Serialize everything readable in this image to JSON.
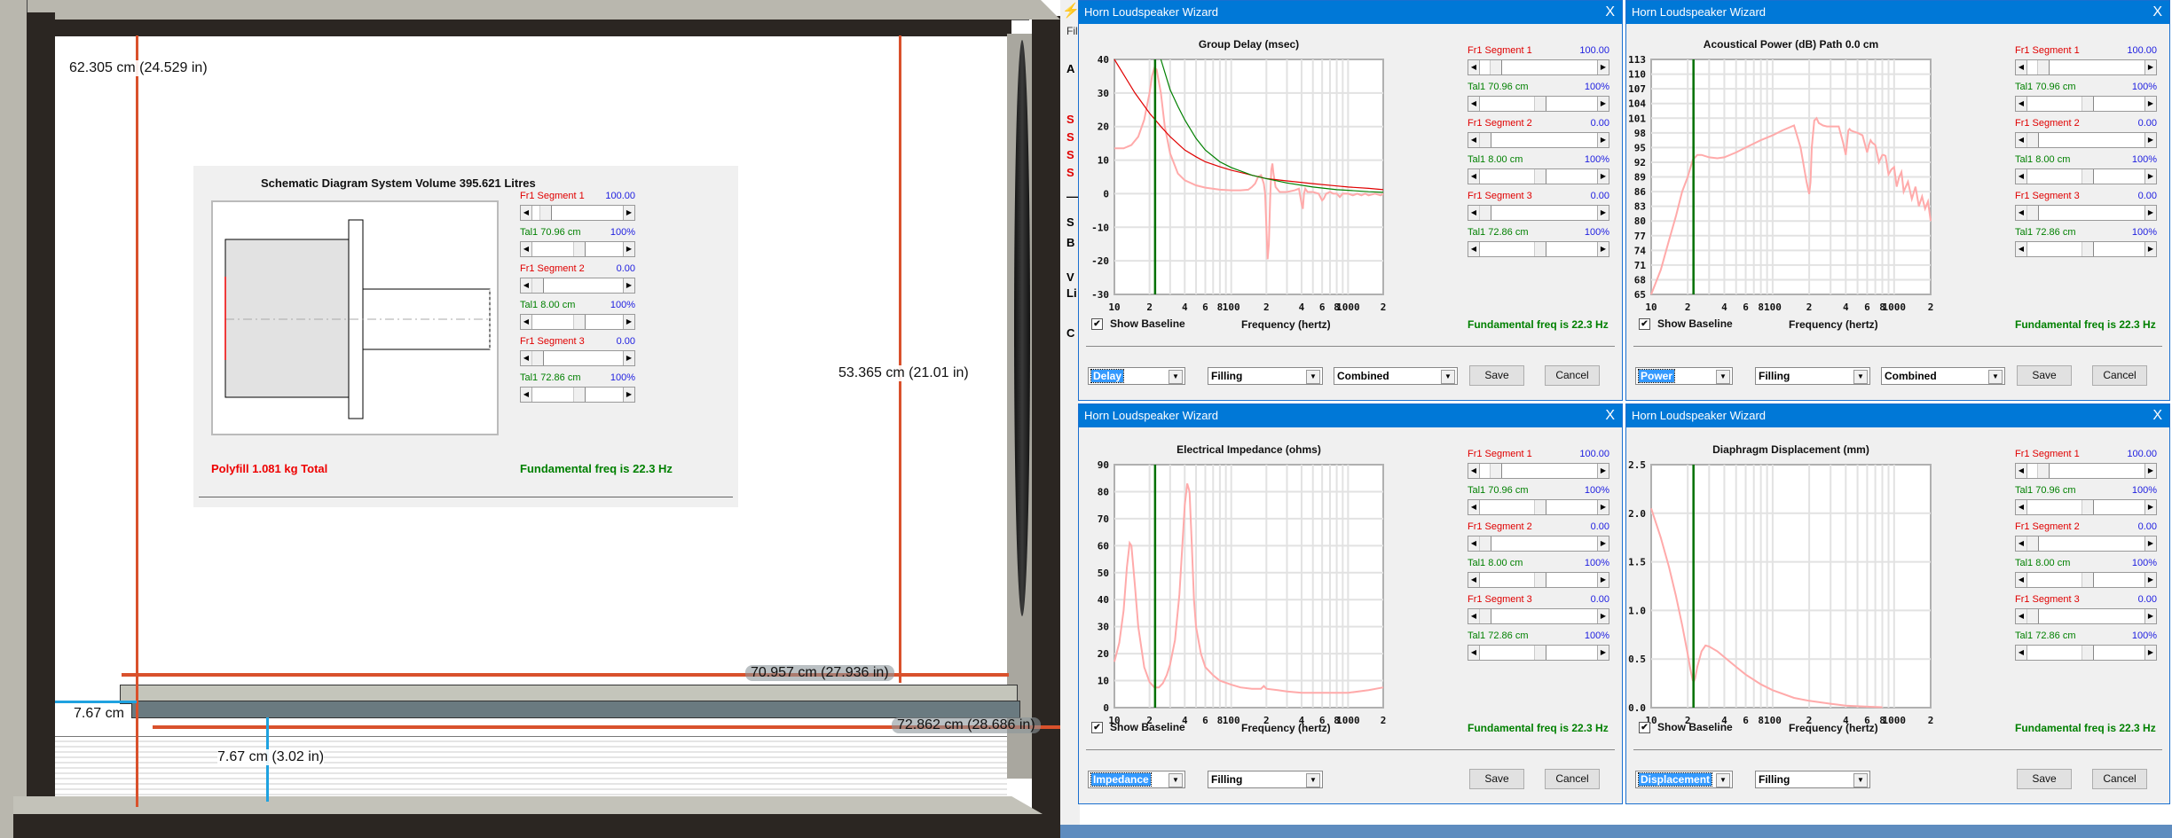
{
  "view3d": {
    "dimensions": {
      "height_left": "62.305 cm (24.529 in)",
      "height_right": "53.365 cm (21.01 in)",
      "panel_length": "70.957 cm (27.936 in)",
      "floor_length": "72.862 cm (28.686 in)",
      "gap_left": "7.67 cm",
      "gap_bottom": "7.67 cm (3.02 in)"
    }
  },
  "schematic": {
    "title": "Schematic Diagram   System Volume 395.621 Litres",
    "polyfill": "Polyfill   1.081 kg   Total",
    "fundamental": "Fundamental freq is 22.3 Hz",
    "sliders": [
      {
        "label": "Fr1  Segment 1",
        "value": "100.00",
        "color": "red",
        "thumb": 0.1
      },
      {
        "label": "Tal1  70.96 cm",
        "value": "100%",
        "color": "green",
        "thumb": 0.5
      },
      {
        "label": "Fr1  Segment 2",
        "value": "0.00",
        "color": "red",
        "thumb": 0.0
      },
      {
        "label": "Tal1  8.00 cm",
        "value": "100%",
        "color": "green",
        "thumb": 0.5
      },
      {
        "label": "Fr1  Segment 3",
        "value": "0.00",
        "color": "red",
        "thumb": 0.0
      },
      {
        "label": "Tal1  72.86 cm",
        "value": "100%",
        "color": "green",
        "thumb": 0.5
      }
    ]
  },
  "bgapp": {
    "menu": "Fil",
    "letters": [
      {
        "t": "A",
        "color": "#000000"
      },
      {
        "t": "S",
        "color": "#e00000"
      },
      {
        "t": "S",
        "color": "#e00000"
      },
      {
        "t": "S",
        "color": "#e00000"
      },
      {
        "t": "S",
        "color": "#e00000"
      },
      {
        "t": "—",
        "color": "#000000"
      },
      {
        "t": "S",
        "color": "#000000"
      },
      {
        "t": "B",
        "color": "#000000"
      },
      {
        "t": "V",
        "color": "#000000"
      },
      {
        "t": "Li",
        "color": "#000000"
      },
      {
        "t": "C",
        "color": "#000000"
      }
    ]
  },
  "windows": [
    {
      "title": "Horn Loudspeaker Wizard",
      "close": "X",
      "show_baseline": "Show Baseline",
      "baseline_checked": true,
      "xlabel": "Frequency (hertz)",
      "fundamental": "Fundamental freq is 22.3 Hz",
      "selects": [
        "Delay",
        "Filling",
        "Combined"
      ],
      "save": "Save",
      "cancel": "Cancel"
    },
    {
      "title": "Horn Loudspeaker Wizard",
      "close": "X",
      "show_baseline": "Show Baseline",
      "baseline_checked": true,
      "xlabel": "Frequency (hertz)",
      "fundamental": "Fundamental freq is 22.3 Hz",
      "selects": [
        "Power",
        "Filling",
        "Combined"
      ],
      "save": "Save",
      "cancel": "Cancel"
    },
    {
      "title": "Horn Loudspeaker Wizard",
      "close": "X",
      "show_baseline": "Show Baseline",
      "baseline_checked": true,
      "xlabel": "Frequency (hertz)",
      "fundamental": "Fundamental freq is 22.3 Hz",
      "selects": [
        "Impedance",
        "Filling"
      ],
      "save": "Save",
      "cancel": "Cancel"
    },
    {
      "title": "Horn Loudspeaker Wizard",
      "close": "X",
      "show_baseline": "Show Baseline",
      "baseline_checked": true,
      "xlabel": "Frequency (hertz)",
      "fundamental": "Fundamental freq is 22.3 Hz",
      "selects": [
        "Displacement",
        "Filling"
      ],
      "save": "Save",
      "cancel": "Cancel"
    }
  ],
  "chart_data": [
    {
      "type": "line",
      "title": "Group Delay (msec)",
      "xlabel": "Frequency (hertz)",
      "xscale": "log",
      "xlim": [
        10,
        2000
      ],
      "ylim": [
        -30,
        40
      ],
      "yticks": [
        40,
        30,
        20,
        10,
        0,
        -10,
        -20,
        -30
      ],
      "xtick_labels": [
        {
          "v": 10,
          "t": "10"
        },
        {
          "v": 20,
          "t": "2"
        },
        {
          "v": 40,
          "t": "4"
        },
        {
          "v": 60,
          "t": "6"
        },
        {
          "v": 80,
          "t": "8"
        },
        {
          "v": 100,
          "t": "100"
        },
        {
          "v": 200,
          "t": "2"
        },
        {
          "v": 400,
          "t": "4"
        },
        {
          "v": 600,
          "t": "6"
        },
        {
          "v": 800,
          "t": "8"
        },
        {
          "v": 1000,
          "t": "1000"
        },
        {
          "v": 2000,
          "t": "2"
        }
      ],
      "grid": true,
      "marker_freq": 22.3,
      "series": [
        {
          "name": "response",
          "color": "#ffaaaa",
          "x": [
            10,
            12,
            14,
            16,
            18,
            20,
            21,
            22,
            23,
            25,
            27,
            30,
            35,
            40,
            50,
            60,
            80,
            100,
            120,
            140,
            150,
            160,
            170,
            180,
            190,
            195,
            200,
            205,
            210,
            215,
            220,
            225,
            230,
            240,
            260,
            300,
            350,
            380,
            400,
            410,
            420,
            430,
            450,
            500,
            560,
            600,
            620,
            650,
            700,
            750,
            800,
            850,
            900,
            1000,
            1100,
            1200,
            1300,
            1400,
            1500,
            1700,
            1900,
            2000
          ],
          "y": [
            13.5,
            13.5,
            14.5,
            17,
            22,
            30,
            35,
            37.5,
            37,
            30,
            20,
            12,
            6,
            4,
            2.5,
            1.8,
            1.2,
            1,
            1,
            1.2,
            2,
            3,
            5,
            5.5,
            3,
            0,
            -10,
            -19.5,
            -15,
            -2,
            7,
            9,
            6,
            2,
            0.5,
            0.5,
            1,
            1.5,
            -3,
            -4.5,
            0,
            1.5,
            0.5,
            0.5,
            0,
            -2,
            -1.5,
            0,
            0.5,
            0,
            0,
            -1,
            0,
            0,
            -0.5,
            0,
            -0.5,
            0,
            -0.5,
            0,
            -0.5,
            0
          ]
        },
        {
          "name": "baseline-red",
          "color": "#e00000",
          "x": [
            10,
            15,
            20,
            25,
            30,
            40,
            50,
            60,
            80,
            100,
            150,
            200,
            300,
            500,
            800,
            1000,
            1500,
            2000
          ],
          "y": [
            40,
            30,
            24,
            20,
            17,
            13,
            11,
            9.5,
            8,
            7,
            5.5,
            4.5,
            3.8,
            3,
            2.3,
            2,
            1.6,
            1.2
          ]
        },
        {
          "name": "baseline-green",
          "color": "#008000",
          "x": [
            25,
            30,
            35,
            40,
            50,
            60,
            80,
            100,
            150,
            200,
            300,
            500,
            800,
            1000,
            1500,
            2000
          ],
          "y": [
            40,
            31,
            26,
            22,
            16.5,
            13,
            9.5,
            7.8,
            5.5,
            4.5,
            3.2,
            2,
            1.2,
            1,
            0.6,
            0.4
          ]
        }
      ]
    },
    {
      "type": "line",
      "title": "Acoustical Power (dB)   Path 0.0 cm",
      "xlabel": "Frequency (hertz)",
      "xscale": "log",
      "xlim": [
        10,
        2000
      ],
      "ylim": [
        65,
        113
      ],
      "yticks": [
        113,
        110,
        107,
        104,
        101,
        98,
        95,
        92,
        89,
        86,
        83,
        80,
        77,
        74,
        71,
        68,
        65
      ],
      "xtick_labels": [
        {
          "v": 10,
          "t": "10"
        },
        {
          "v": 20,
          "t": "2"
        },
        {
          "v": 40,
          "t": "4"
        },
        {
          "v": 60,
          "t": "6"
        },
        {
          "v": 80,
          "t": "8"
        },
        {
          "v": 100,
          "t": "100"
        },
        {
          "v": 200,
          "t": "2"
        },
        {
          "v": 400,
          "t": "4"
        },
        {
          "v": 600,
          "t": "6"
        },
        {
          "v": 800,
          "t": "8"
        },
        {
          "v": 1000,
          "t": "1000"
        },
        {
          "v": 2000,
          "t": "2"
        }
      ],
      "grid": true,
      "marker_freq": 22.3,
      "series": [
        {
          "name": "response",
          "color": "#ffaaaa",
          "x": [
            10,
            12,
            14,
            16,
            18,
            20,
            22,
            24,
            26,
            30,
            35,
            40,
            50,
            60,
            80,
            100,
            120,
            150,
            170,
            190,
            200,
            205,
            210,
            220,
            230,
            240,
            260,
            280,
            300,
            350,
            380,
            400,
            410,
            420,
            430,
            440,
            460,
            500,
            550,
            600,
            620,
            640,
            660,
            700,
            750,
            800,
            820,
            850,
            900,
            950,
            1000,
            1050,
            1100,
            1150,
            1200,
            1300,
            1400,
            1500,
            1600,
            1700,
            1800,
            1900,
            2000
          ],
          "y": [
            65,
            70,
            76,
            81,
            86,
            89,
            92.5,
            93.5,
            93.5,
            93,
            92.8,
            93,
            94,
            95,
            96.5,
            97.5,
            98.5,
            99.5,
            95,
            88,
            85.5,
            88,
            95,
            100.5,
            101,
            100,
            99.5,
            99.3,
            99.3,
            99.3,
            96,
            93.5,
            96,
            98.5,
            98.8,
            98.5,
            98.3,
            98,
            97.5,
            94,
            95.5,
            96.5,
            96,
            95.5,
            92,
            93.5,
            93.5,
            93.3,
            89.5,
            90.5,
            91,
            87,
            89,
            90,
            86,
            88,
            84.5,
            87,
            83,
            85,
            82.5,
            84,
            80
          ]
        }
      ]
    },
    {
      "type": "line",
      "title": "Electrical Impedance (ohms)",
      "xlabel": "Frequency (hertz)",
      "xscale": "log",
      "xlim": [
        10,
        2000
      ],
      "ylim": [
        0,
        90
      ],
      "yticks": [
        90,
        80,
        70,
        60,
        50,
        40,
        30,
        20,
        10,
        0
      ],
      "xtick_labels": [
        {
          "v": 10,
          "t": "10"
        },
        {
          "v": 20,
          "t": "2"
        },
        {
          "v": 40,
          "t": "4"
        },
        {
          "v": 60,
          "t": "6"
        },
        {
          "v": 80,
          "t": "8"
        },
        {
          "v": 100,
          "t": "100"
        },
        {
          "v": 200,
          "t": "2"
        },
        {
          "v": 400,
          "t": "4"
        },
        {
          "v": 600,
          "t": "6"
        },
        {
          "v": 800,
          "t": "8"
        },
        {
          "v": 1000,
          "t": "1000"
        },
        {
          "v": 2000,
          "t": "2"
        }
      ],
      "grid": true,
      "marker_freq": 22.3,
      "series": [
        {
          "name": "response",
          "color": "#ffaaaa",
          "x": [
            10,
            11,
            12,
            12.8,
            13.5,
            14,
            15,
            16,
            18,
            20,
            22,
            24,
            26,
            28,
            30,
            33,
            36,
            40,
            42,
            44,
            46,
            48,
            50,
            55,
            60,
            70,
            80,
            100,
            120,
            150,
            180,
            190,
            200,
            250,
            300,
            400,
            500,
            700,
            1000,
            1500,
            2000
          ],
          "y": [
            17,
            24,
            36,
            52,
            61,
            60,
            45,
            30,
            15,
            9.5,
            7.5,
            7.5,
            9,
            12,
            16,
            25,
            42,
            75,
            83,
            80,
            60,
            40,
            30,
            20,
            15,
            12,
            10,
            8.5,
            7.5,
            7,
            7,
            8,
            7,
            6.5,
            6,
            5.5,
            5.5,
            5.5,
            5.5,
            6.5,
            7.5
          ]
        }
      ]
    },
    {
      "type": "line",
      "title": "Diaphragm Displacement (mm)",
      "xlabel": "Frequency (hertz)",
      "xscale": "log",
      "xlim": [
        10,
        2000
      ],
      "ylim": [
        0,
        2.5
      ],
      "yticks": [
        "2.5",
        "2.0",
        "1.5",
        "1.0",
        "0.5",
        "0.0"
      ],
      "xtick_labels": [
        {
          "v": 10,
          "t": "10"
        },
        {
          "v": 20,
          "t": "2"
        },
        {
          "v": 40,
          "t": "4"
        },
        {
          "v": 60,
          "t": "6"
        },
        {
          "v": 80,
          "t": "8"
        },
        {
          "v": 100,
          "t": "100"
        },
        {
          "v": 200,
          "t": "2"
        },
        {
          "v": 400,
          "t": "4"
        },
        {
          "v": 600,
          "t": "6"
        },
        {
          "v": 800,
          "t": "8"
        },
        {
          "v": 1000,
          "t": "1000"
        },
        {
          "v": 2000,
          "t": "2"
        }
      ],
      "grid": true,
      "marker_freq": 22.3,
      "series": [
        {
          "name": "response",
          "color": "#ffaaaa",
          "x": [
            10,
            12,
            14,
            16,
            18,
            20,
            21,
            22,
            22.5,
            23,
            24,
            26,
            28,
            30,
            35,
            40,
            50,
            60,
            80,
            100,
            150,
            200,
            300,
            400,
            500,
            600,
            800
          ],
          "y": [
            2.05,
            1.75,
            1.45,
            1.15,
            0.85,
            0.55,
            0.4,
            0.28,
            0.27,
            0.3,
            0.42,
            0.58,
            0.64,
            0.63,
            0.58,
            0.52,
            0.42,
            0.34,
            0.24,
            0.18,
            0.1,
            0.07,
            0.04,
            0.02,
            0.015,
            0.01,
            0.005
          ]
        }
      ]
    }
  ]
}
